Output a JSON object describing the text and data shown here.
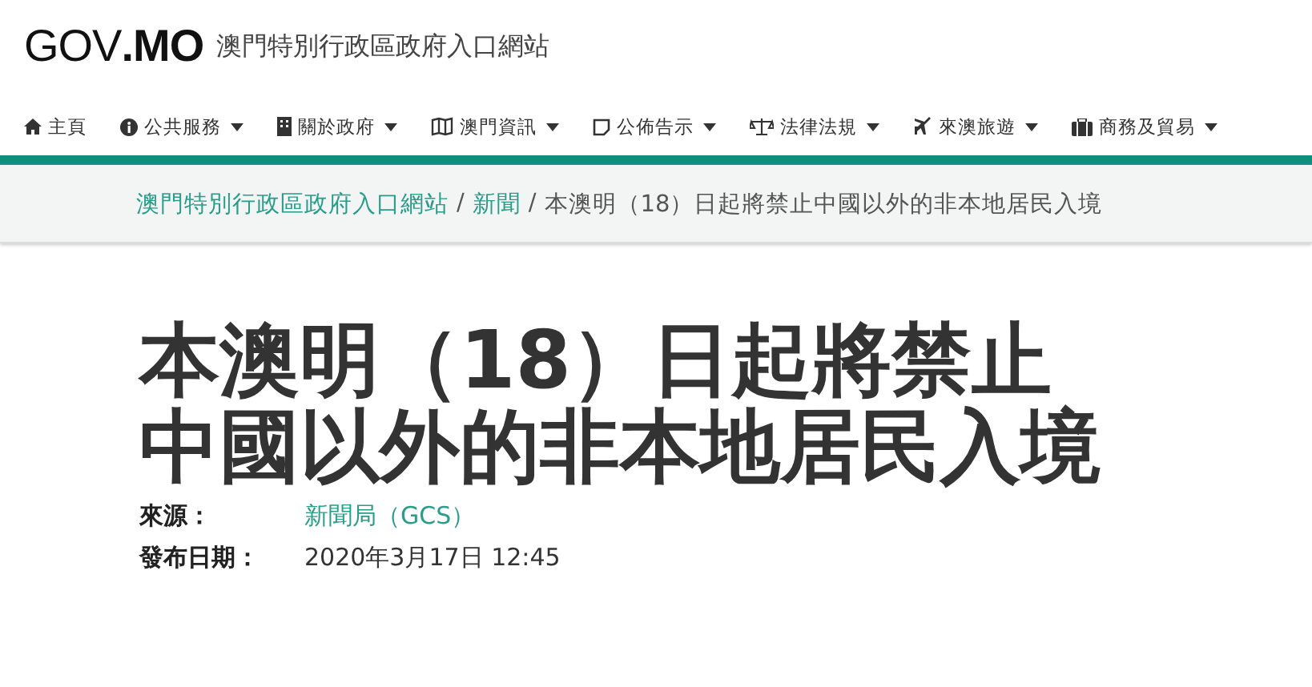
{
  "header": {
    "logo": "GOV**.MO**",
    "site_name": "澳門特別行政區政府入口網站"
  },
  "nav": [
    {
      "label": "主頁",
      "kind": "home",
      "dropdown": false
    },
    {
      "label": "公共服務",
      "kind": "info",
      "dropdown": true
    },
    {
      "label": "關於政府",
      "kind": "building",
      "dropdown": true
    },
    {
      "label": "澳門資訊",
      "kind": "map",
      "dropdown": true
    },
    {
      "label": "公佈告示",
      "kind": "notice",
      "dropdown": true
    },
    {
      "label": "法律法規",
      "kind": "scale",
      "dropdown": true
    },
    {
      "label": "來澳旅遊",
      "kind": "plane",
      "dropdown": true
    },
    {
      "label": "商務及貿易",
      "kind": "briefcase",
      "dropdown": true
    }
  ],
  "breadcrumb_separator": "/",
  "breadcrumb": [
    {
      "label": "澳門特別行政區政府入口網站",
      "link": true
    },
    {
      "label": "新聞",
      "link": true
    },
    {
      "label": "本澳明（18）日起將禁止中國以外的非本地居民入境",
      "link": false
    }
  ],
  "article": {
    "title": "本澳明（18）日起將禁止中國以外的非本地居民入境",
    "meta": [
      {
        "label": "來源：",
        "value": "新聞局（GCS）",
        "link": true
      },
      {
        "label": "發布日期：",
        "value": "2020年3月17日 12:45",
        "link": false
      }
    ]
  }
}
